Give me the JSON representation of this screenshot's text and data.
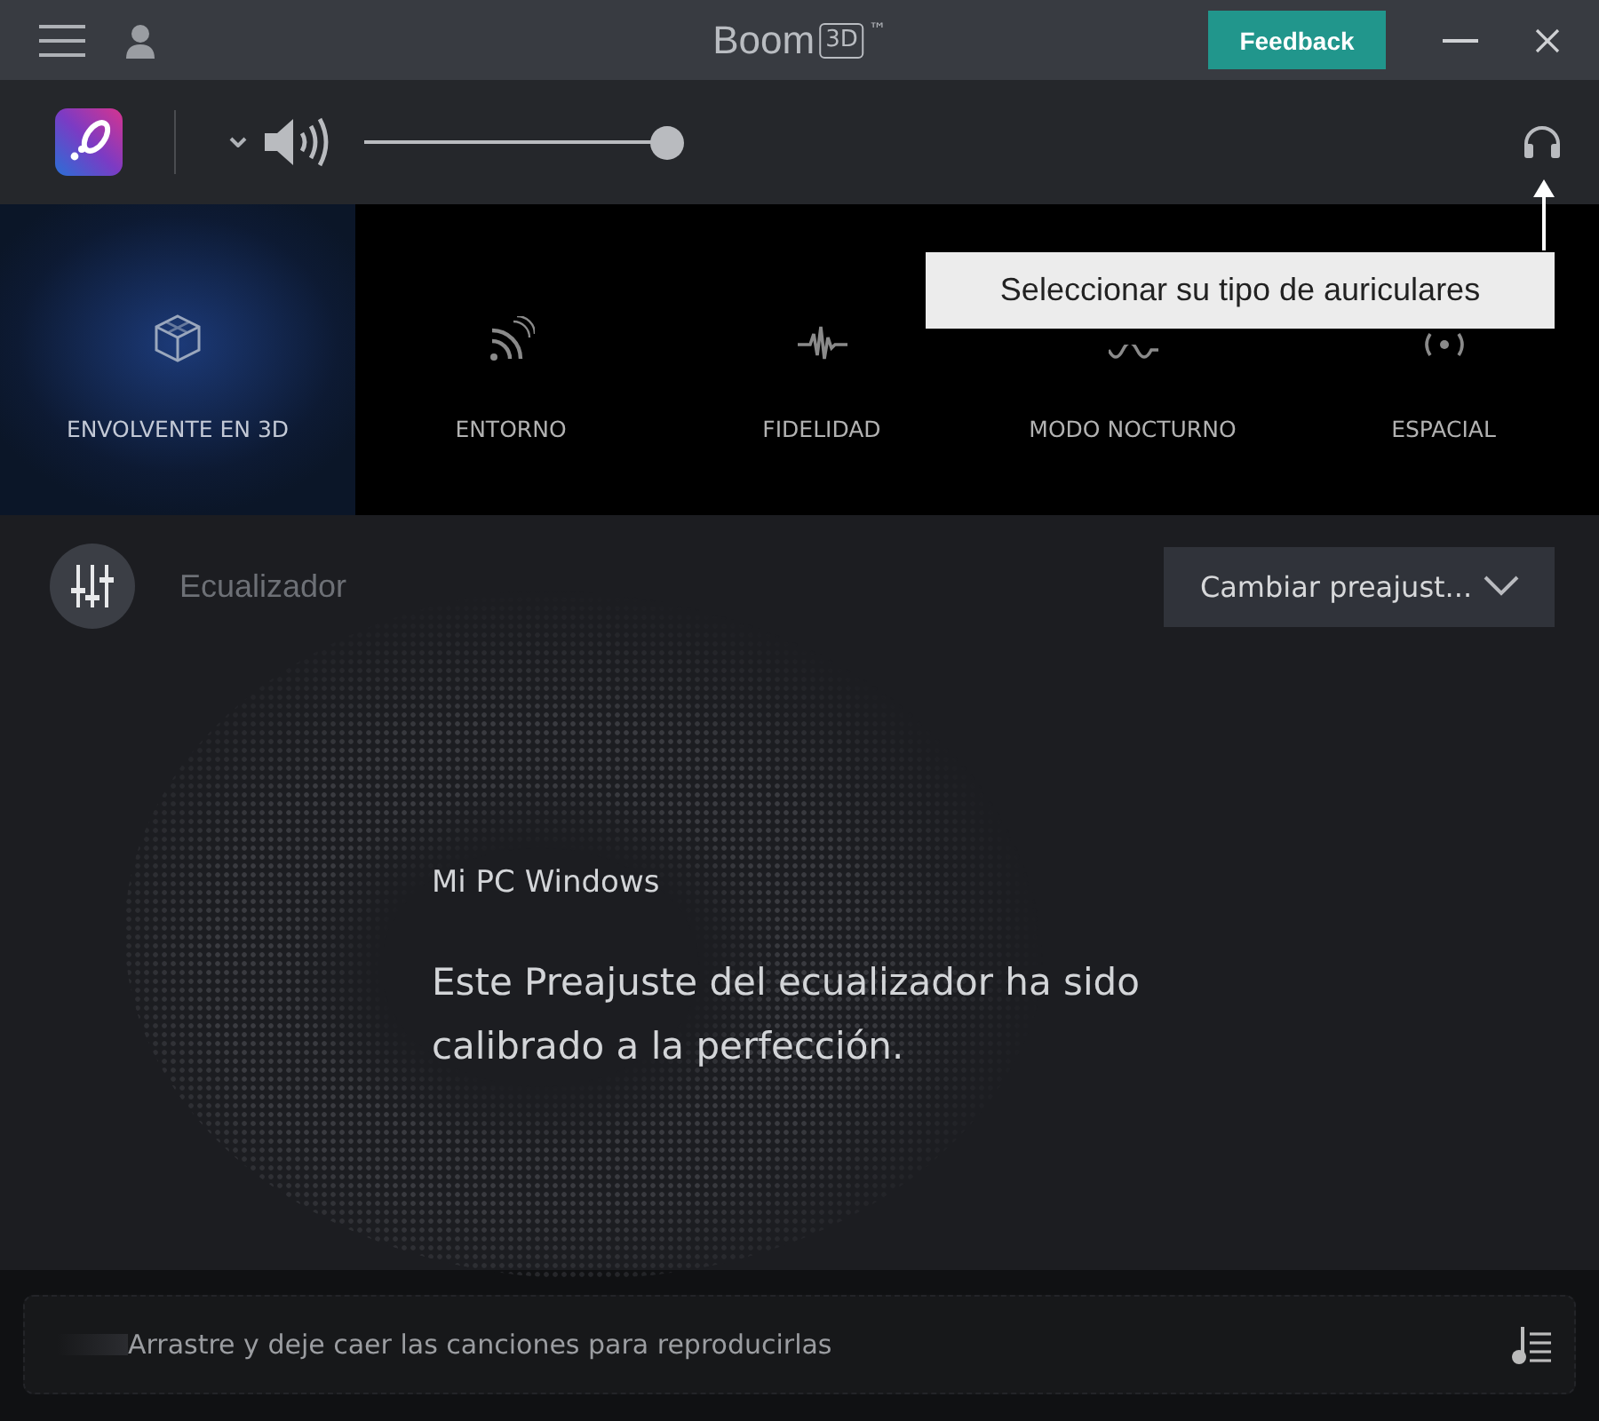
{
  "title_bar": {
    "brand": "Boom",
    "badge": "3D",
    "trademark": "™",
    "feedback_button": "Feedback"
  },
  "toolbar": {
    "volume": {
      "level": 1
    }
  },
  "tooltip": {
    "text": "Seleccionar su tipo de auriculares"
  },
  "modes": [
    {
      "kind": "cube",
      "label": "ENVOLVENTE EN 3D",
      "selected": true
    },
    {
      "kind": "ambience",
      "label": "ENTORNO",
      "selected": false
    },
    {
      "kind": "fidelity",
      "label": "FIDELIDAD",
      "selected": false
    },
    {
      "kind": "night",
      "label": "MODO NOCTURNO",
      "selected": false
    },
    {
      "kind": "spatial",
      "label": "ESPACIAL",
      "selected": false
    }
  ],
  "equalizer": {
    "label": "Ecualizador",
    "preset_button": "Cambiar preajust...",
    "preset_name": "Mi PC Windows",
    "description": "Este Preajuste del ecualizador ha sido calibrado a la perfección."
  },
  "drop_zone": {
    "text": "Arrastre y deje caer las canciones para reproducirlas"
  }
}
